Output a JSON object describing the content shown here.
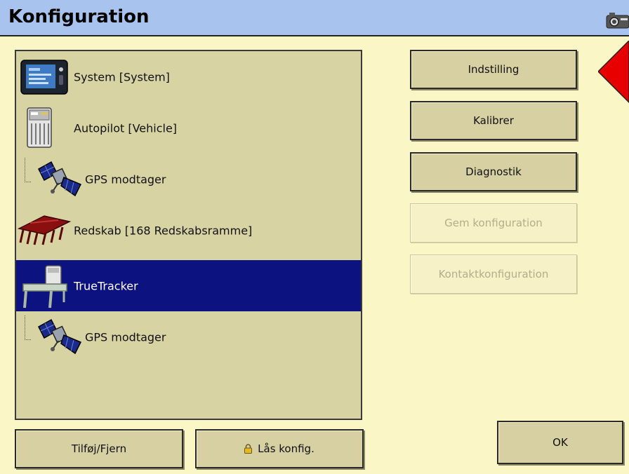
{
  "window": {
    "title": "Konfiguration"
  },
  "components": [
    {
      "label": "System [System]",
      "icon": "display-terminal-icon",
      "child": false,
      "selected": false
    },
    {
      "label": "Autopilot [Vehicle]",
      "icon": "controller-box-icon",
      "child": false,
      "selected": false
    },
    {
      "label": "GPS modtager",
      "icon": "satellite-icon",
      "child": true,
      "selected": false
    },
    {
      "label": "Redskab [168 Redskabsramme]",
      "icon": "cultivator-icon",
      "child": false,
      "selected": false
    },
    {
      "label": "TrueTracker",
      "icon": "truetracker-icon",
      "child": false,
      "selected": true
    },
    {
      "label": "GPS modtager",
      "icon": "satellite-icon",
      "child": true,
      "selected": false
    }
  ],
  "actions": {
    "setup": "Indstilling",
    "calibrate": "Kalibrer",
    "diagnostics": "Diagnostik",
    "save_config": "Gem konfiguration",
    "contact_config": "Kontaktkonfiguration"
  },
  "footer": {
    "add_remove": "Tilføj/Fjern",
    "lock_config": "Lås konfig.",
    "ok": "OK"
  },
  "colors": {
    "background": "#fbf6c6",
    "titlebar": "#a8c4ee",
    "list_background": "#d8d3a3",
    "selection": "#0c1280",
    "alert": "#e60000"
  }
}
